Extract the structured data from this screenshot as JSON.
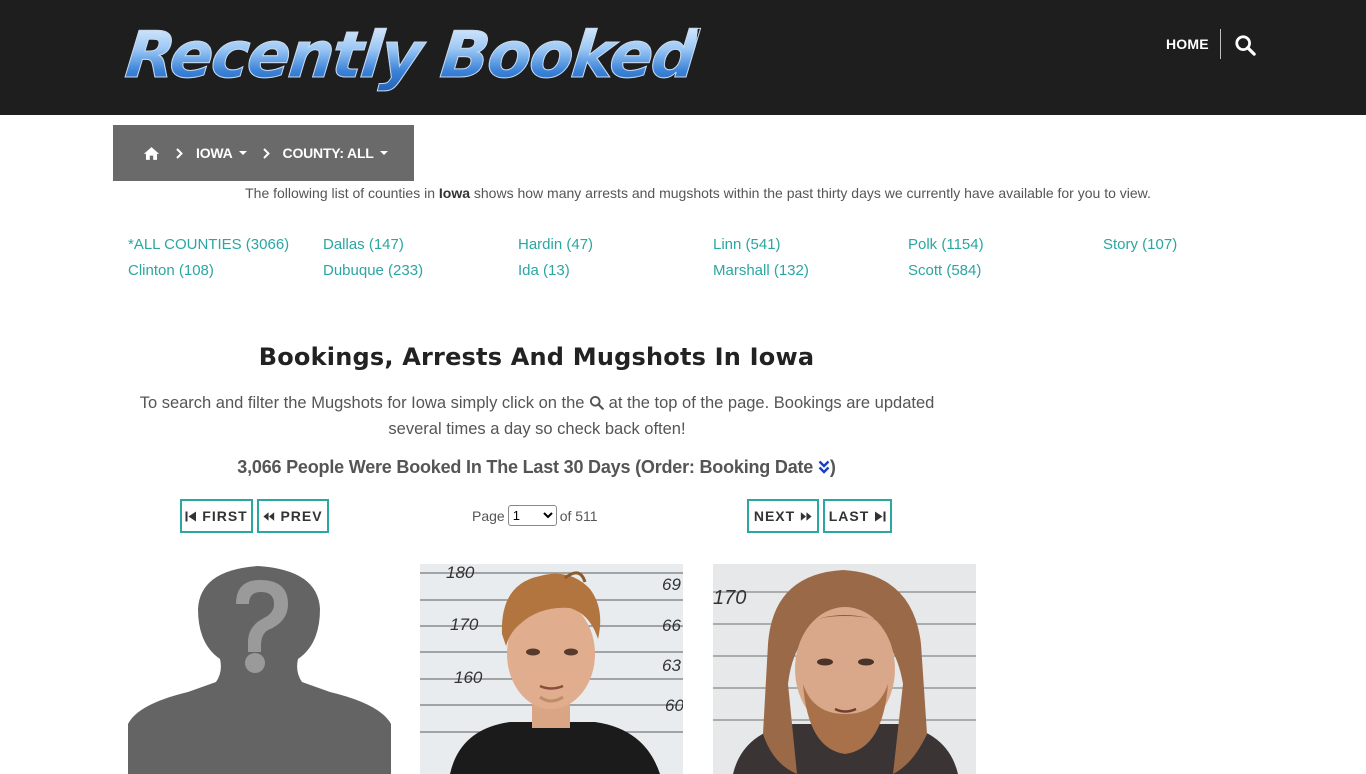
{
  "header": {
    "logo_text": "Recently Booked",
    "nav_home": "HOME",
    "search_icon": "search-icon"
  },
  "breadcrumb": {
    "home_icon": "home-icon",
    "state": "IOWA",
    "county": "COUNTY: ALL"
  },
  "intro": {
    "prefix": "The following list of counties in ",
    "state": "Iowa",
    "suffix": " shows how many arrests and mugshots within the past thirty days we currently have available for you to view."
  },
  "counties": [
    "*ALL COUNTIES (3066)",
    "Dallas (147)",
    "Hardin (47)",
    "Linn (541)",
    "Polk (1154)",
    "Story (107)",
    "Clinton (108)",
    "Dubuque (233)",
    "Ida (13)",
    "Marshall (132)",
    "Scott (584)"
  ],
  "section": {
    "title": "Bookings, Arrests And Mugshots In Iowa",
    "desc_prefix": "To search and filter the Mugshots for Iowa simply click on the ",
    "desc_suffix": " at the top of the page. Bookings are updated several times a day so check back often!",
    "count_text": "3,066 People Were Booked In The Last 30 Days (Order: Booking Date ",
    "count_close": ")"
  },
  "pager": {
    "first": "FIRST",
    "prev": "PREV",
    "next": "NEXT",
    "last": "LAST",
    "page_label": "Page",
    "page_value": "1",
    "of_label": "of 511"
  },
  "mugshot_scale": {
    "left": [
      "180",
      "170",
      "160"
    ],
    "right": [
      "69",
      "66",
      "63",
      "60"
    ],
    "right2": [
      "170"
    ]
  },
  "colors": {
    "header_bg": "#1e1e1e",
    "accent": "#2aa6a3",
    "breadcrumb_bg": "#6a6a6a"
  }
}
